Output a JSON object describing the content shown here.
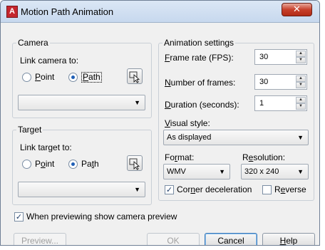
{
  "window": {
    "title": "Motion Path Animation",
    "app_icon_letter": "A",
    "close_glyph": "✕"
  },
  "camera": {
    "group_label": "Camera",
    "link_label": "Link camera to:",
    "point_label": "Point",
    "path_label": "Path",
    "selected": "Path",
    "combo_value": ""
  },
  "target": {
    "group_label": "Target",
    "link_label": "Link target to:",
    "point_label": "Point",
    "path_label": "Path",
    "selected": "Path",
    "combo_value": ""
  },
  "animation": {
    "group_label": "Animation settings",
    "frame_rate_label": "Frame rate (FPS):",
    "frame_rate_value": "30",
    "num_frames_label": "Number of frames:",
    "num_frames_value": "30",
    "duration_label": "Duration (seconds):",
    "duration_value": "1",
    "visual_style_label": "Visual style:",
    "visual_style_value": "As displayed",
    "format_label": "Format:",
    "format_value": "WMV",
    "resolution_label": "Resolution:",
    "resolution_value": "320 x 240",
    "corner_decel_label": "Corner deceleration",
    "corner_decel_checked": true,
    "reverse_label": "Reverse",
    "reverse_checked": false
  },
  "preview_checkbox": {
    "label": "When previewing show camera preview",
    "checked": true
  },
  "buttons": {
    "preview": "Preview...",
    "ok": "OK",
    "cancel": "Cancel",
    "help": "Help"
  },
  "colors": {
    "title_gradient_top": "#dbe7f5",
    "close_red": "#c7402b",
    "accent_blue": "#1f5fb6"
  }
}
